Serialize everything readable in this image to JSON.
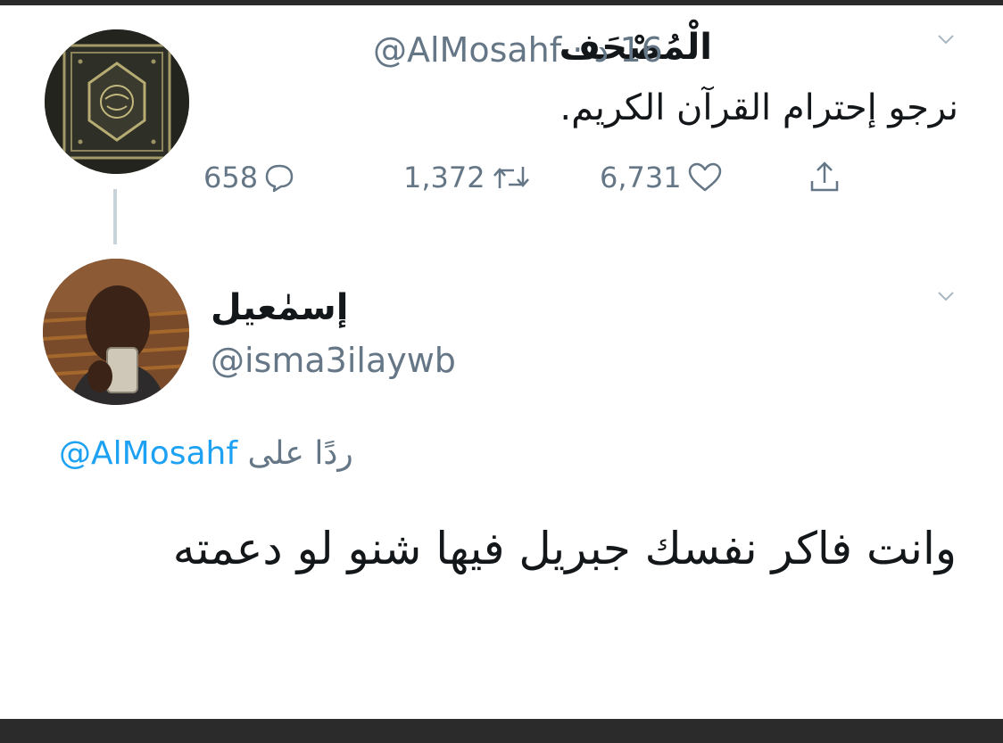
{
  "tweet": {
    "display_name": "الْمُصْحَف",
    "handle": "@AlMosahf",
    "separator": "·",
    "time": "16 د",
    "text": "نرجو إحترام القرآن الكريم.",
    "actions": {
      "replies": "658",
      "retweets": "1,372",
      "likes": "6,731"
    }
  },
  "reply": {
    "display_name": "إسمٰعيل",
    "handle": "@isma3ilaywb",
    "replying_prefix": "ردًا على",
    "replying_to": "@AlMosahf",
    "text": "وانت فاكر نفسك جبريل فيها شنو لو دعمته"
  },
  "colors": {
    "secondary_text": "#657786",
    "link": "#1da1f2",
    "frame": "#2b2b2b",
    "thread_line": "#c9d3da"
  },
  "icons": [
    "chevron-down-icon",
    "reply-icon",
    "retweet-icon",
    "heart-icon",
    "share-icon"
  ]
}
